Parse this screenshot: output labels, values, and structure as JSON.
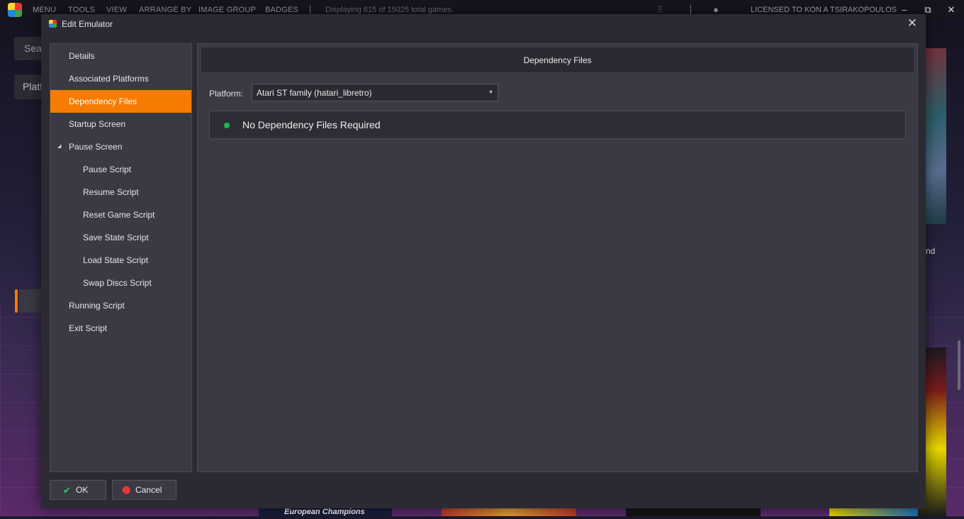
{
  "app": {
    "menu": [
      "MENU",
      "TOOLS",
      "VIEW",
      "ARRANGE BY",
      "IMAGE GROUP",
      "BADGES"
    ],
    "status": "Displaying 615 of 15025 total games.",
    "license": "LICENSED TO KON A TSIRAKOPOULOS",
    "window_buttons": {
      "minimize": "–",
      "restore": "⧉",
      "close": "✕"
    },
    "search_partial": "Sea",
    "platform_partial": "Platf",
    "side_text_partial": "nd",
    "box_art_text": "European Champions"
  },
  "dialog": {
    "title": "Edit Emulator",
    "close_glyph": "✕",
    "nav": [
      {
        "label": "Details",
        "level": 1
      },
      {
        "label": "Associated Platforms",
        "level": 1
      },
      {
        "label": "Dependency Files",
        "level": 1,
        "active": true
      },
      {
        "label": "Startup Screen",
        "level": 1
      },
      {
        "label": "Pause Screen",
        "level": 1,
        "expanded": true
      },
      {
        "label": "Pause Script",
        "level": 2
      },
      {
        "label": "Resume Script",
        "level": 2
      },
      {
        "label": "Reset Game Script",
        "level": 2
      },
      {
        "label": "Save State Script",
        "level": 2
      },
      {
        "label": "Load State Script",
        "level": 2
      },
      {
        "label": "Swap Discs Script",
        "level": 2
      },
      {
        "label": "Running Script",
        "level": 1
      },
      {
        "label": "Exit Script",
        "level": 1
      }
    ],
    "content": {
      "header": "Dependency Files",
      "platform_label": "Platform:",
      "platform_value": "Atari ST family (hatari_libretro)",
      "dependency_status": "No Dependency Files Required",
      "status_color": "#1db954"
    },
    "buttons": {
      "ok": "OK",
      "cancel": "Cancel"
    }
  },
  "colors": {
    "accent": "#f57c00",
    "panel": "#3a3944",
    "dialog_bg": "#2b2a33"
  }
}
